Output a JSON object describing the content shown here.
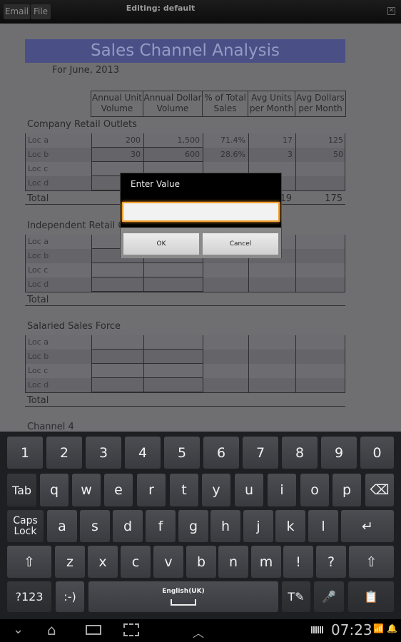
{
  "topbar": {
    "email": "Email",
    "file": "File",
    "title": "Editing: default",
    "icon": "close-icon"
  },
  "doc": {
    "title": "Sales Channel Analysis",
    "subtitle": "For June, 2013",
    "headers": [
      "Annual Unit Volume",
      "Annual Dollar Volume",
      "% of Total Sales",
      "Avg Units per Month",
      "Avg Dollars per Month"
    ],
    "sections": [
      {
        "name": "Company Retail Outlets",
        "rows": [
          [
            "Loc a",
            "200",
            "1,500",
            "71.4%",
            "17",
            "125"
          ],
          [
            "Loc b",
            "30",
            "600",
            "28.6%",
            "3",
            "50"
          ],
          [
            "Loc c",
            "",
            "",
            "",
            "",
            ""
          ],
          [
            "Loc d",
            "",
            "",
            "",
            "",
            ""
          ]
        ],
        "total": [
          "Total",
          "",
          "",
          "",
          "19",
          "175"
        ]
      },
      {
        "name": "Independent Retail Outlets",
        "rows": [
          [
            "Loc a",
            "",
            "",
            "",
            "",
            ""
          ],
          [
            "Loc b",
            "",
            "",
            "",
            "",
            ""
          ],
          [
            "Loc c",
            "",
            "",
            "",
            "",
            ""
          ],
          [
            "Loc d",
            "",
            "",
            "",
            "",
            ""
          ]
        ],
        "total": [
          "Total",
          "",
          "",
          "",
          "",
          ""
        ]
      },
      {
        "name": "Salaried Sales Force",
        "rows": [
          [
            "Loc a",
            "",
            "",
            "",
            "",
            ""
          ],
          [
            "Loc b",
            "",
            "",
            "",
            "",
            ""
          ],
          [
            "Loc c",
            "",
            "",
            "",
            "",
            ""
          ],
          [
            "Loc d",
            "",
            "",
            "",
            "",
            ""
          ]
        ],
        "total": [
          "Total",
          "",
          "",
          "",
          "",
          ""
        ]
      }
    ],
    "next_section": "Channel 4"
  },
  "dialog": {
    "title": "Enter Value",
    "value": "",
    "ok": "OK",
    "cancel": "Cancel"
  },
  "keyboard": {
    "rows": [
      [
        "1",
        "2",
        "3",
        "4",
        "5",
        "6",
        "7",
        "8",
        "9",
        "0"
      ],
      [
        "Tab",
        "q",
        "w",
        "e",
        "r",
        "t",
        "y",
        "u",
        "i",
        "o",
        "p",
        "⌫"
      ],
      [
        "Caps Lock",
        "a",
        "s",
        "d",
        "f",
        "g",
        "h",
        "j",
        "k",
        "l",
        "↵"
      ],
      [
        "⇧",
        "z",
        "x",
        "c",
        "v",
        "b",
        "n",
        "m",
        "!",
        "?",
        "⇧"
      ],
      [
        "?123",
        ":-)",
        "English(UK)",
        "T✎",
        "🎤",
        "📋"
      ]
    ]
  },
  "status": {
    "time": "07:23"
  }
}
